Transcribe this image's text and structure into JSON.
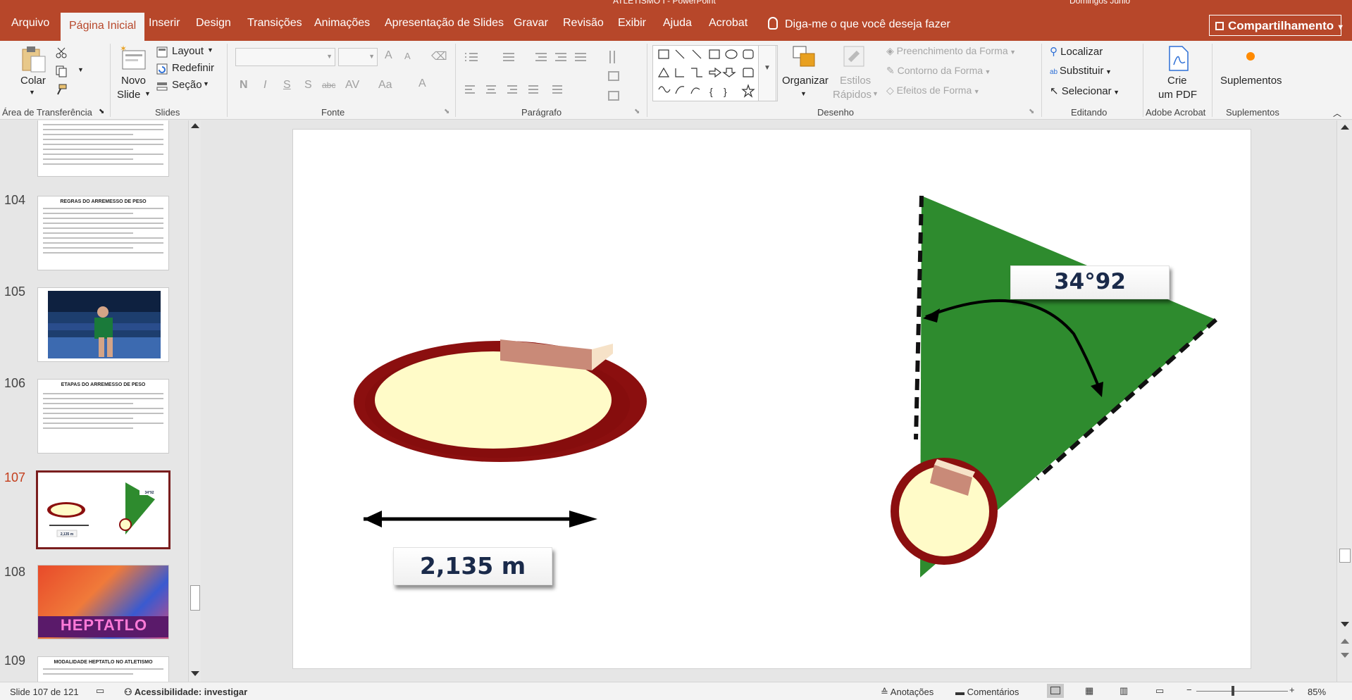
{
  "window": {
    "title": "ATLETISMO I  -  PowerPoint",
    "user": "Domingos Junio"
  },
  "tabs": [
    "Arquivo",
    "Página Inicial",
    "Inserir",
    "Design",
    "Transições",
    "Animações",
    "Apresentação de Slides",
    "Gravar",
    "Revisão",
    "Exibir",
    "Ajuda",
    "Acrobat"
  ],
  "active_tab": "Página Inicial",
  "tell_me": "Diga-me o que você deseja fazer",
  "share_label": "Compartilhamento",
  "ribbon": {
    "clipboard": {
      "paste": "Colar",
      "group": "Área de Transferência"
    },
    "slides": {
      "new_slide_1": "Novo",
      "new_slide_2": "Slide",
      "layout": "Layout",
      "reset": "Redefinir",
      "section": "Seção",
      "group": "Slides"
    },
    "font": {
      "group": "Fonte",
      "bold": "N",
      "italic": "I",
      "underline": "S",
      "shadow": "S",
      "strike": "abc",
      "spacing": "AV",
      "case": "Aa",
      "color": "A",
      "grow": "A",
      "shrink": "A"
    },
    "paragraph": {
      "group": "Parágrafo"
    },
    "drawing": {
      "arrange": "Organizar",
      "quick_styles_1": "Estilos",
      "quick_styles_2": "Rápidos",
      "fill": "Preenchimento da Forma",
      "outline": "Contorno da Forma",
      "effects": "Efeitos de Forma",
      "group": "Desenho"
    },
    "editing": {
      "find": "Localizar",
      "replace": "Substituir",
      "select": "Selecionar",
      "group": "Editando"
    },
    "acrobat": {
      "create_1": "Crie",
      "create_2": "um PDF",
      "group": "Adobe Acrobat"
    },
    "addins": {
      "label": "Suplementos",
      "group": "Suplementos"
    }
  },
  "thumbnails": [
    {
      "num": "104",
      "title": "REGRAS DO ARREMESSO DE PESO"
    },
    {
      "num": "105",
      "title": ""
    },
    {
      "num": "106",
      "title": "ETAPAS DO ARREMESSO DE PESO"
    },
    {
      "num": "107",
      "title": ""
    },
    {
      "num": "108",
      "title": "HEPTATLO"
    },
    {
      "num": "109",
      "title": "MODALIDADE HEPTATLO NO ATLETISMO"
    }
  ],
  "selected_slide": "107",
  "slide": {
    "distance_label": "2,135 m",
    "angle_label": "34°92"
  },
  "thumb_107": {
    "angle": "34°92",
    "distance": "2,135 m"
  },
  "status": {
    "slide_pos": "Slide 107 de 121",
    "accessibility": "Acessibilidade: investigar",
    "notes": "Anotações",
    "comments": "Comentários",
    "zoom": "85%"
  },
  "colors": {
    "accent": "#b7472a",
    "field_green": "#2e8b2e",
    "ring_red": "#8b0f0f",
    "ring_fill": "#fffbc8"
  }
}
